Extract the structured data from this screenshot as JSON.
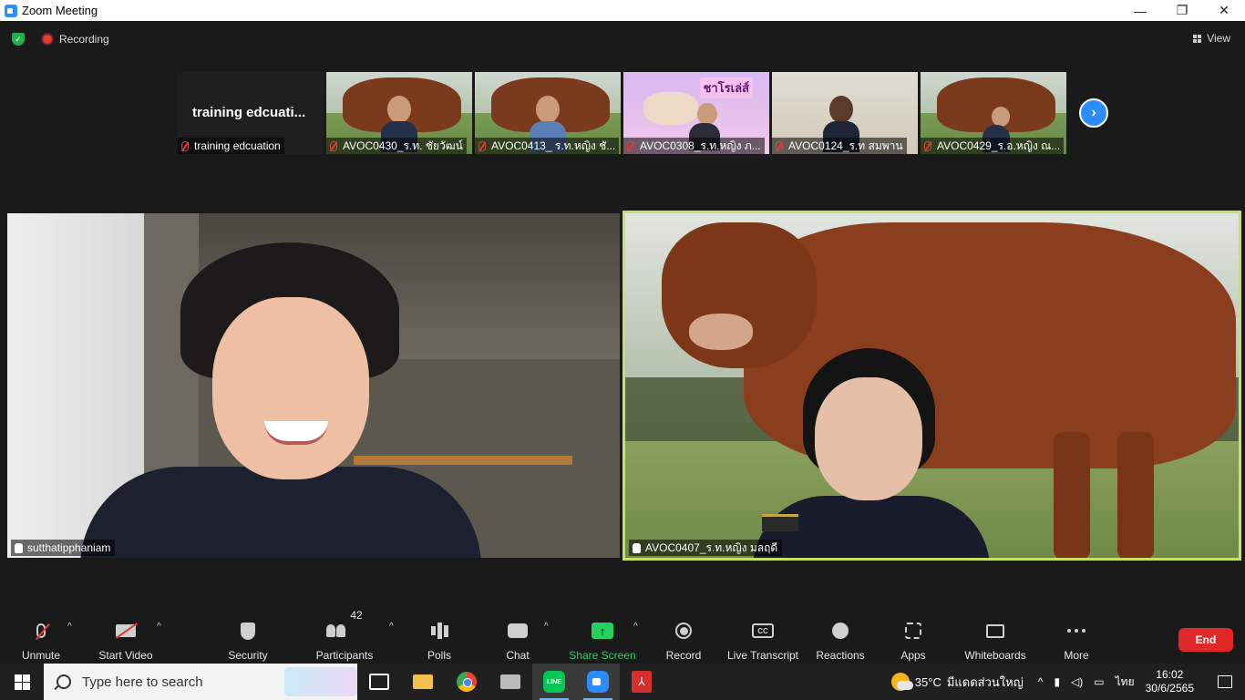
{
  "window": {
    "title": "Zoom Meeting",
    "minimize": "—",
    "restore": "❐",
    "close": "✕"
  },
  "topbar": {
    "security_mark": "✓",
    "recording_label": "Recording",
    "view_label": "View"
  },
  "thumbnails": [
    {
      "big_name": "training  edcuati...",
      "label": "training edcuation"
    },
    {
      "label": "AVOC0430_ร.ท. ชัยวัฒน์"
    },
    {
      "label": "AVOC0413_ ร.ท.หญิง ชั..."
    },
    {
      "label": "AVOC0308_ร.ท.หญิง ภ...",
      "badge": "ชาโรเล่ส์"
    },
    {
      "label": "AVOC0124_ร.ท สมพาน"
    },
    {
      "label": "AVOC0429_ร.อ.หญิง ณ..."
    }
  ],
  "next_page": "›",
  "videos": {
    "left_name": "sutthatipphaniam",
    "right_name": "AVOC0407_ร.ท.หญิง มลฤดี"
  },
  "toolbar": {
    "unmute": "Unmute",
    "start_video": "Start Video",
    "security": "Security",
    "participants": "Participants",
    "participants_count": "42",
    "polls": "Polls",
    "chat": "Chat",
    "share_screen": "Share Screen",
    "share_arrow": "↑",
    "record": "Record",
    "live_transcript": "Live Transcript",
    "cc_icon_text": "CC",
    "reactions": "Reactions",
    "apps": "Apps",
    "whiteboards": "Whiteboards",
    "more": "More",
    "end": "End",
    "caret": "^"
  },
  "taskbar": {
    "search_placeholder": "Type here to search",
    "line_text": "LINE",
    "pdf_text": "⅄",
    "temperature": "35°C",
    "weather_text": "มีแดดส่วนใหญ่",
    "chevron": "^",
    "language": "ไทย",
    "time": "16:02",
    "date": "30/6/2565"
  },
  "colors": {
    "zoom_blue": "#2d8cff",
    "active_speaker": "#c7e06a",
    "share_green": "#23d160",
    "end_red": "#e02828",
    "recording_red": "#e53935"
  }
}
